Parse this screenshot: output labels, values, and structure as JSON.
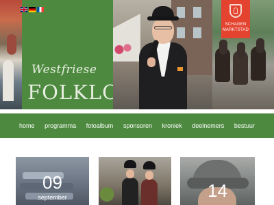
{
  "hero": {
    "title_script": "Westfriese",
    "title_main": "FOLKLORE",
    "badge": {
      "line1": "SCHAGEN",
      "line2": "MARKTSTAD",
      "color": "#e3432f",
      "icon": "shield-icon"
    }
  },
  "languages": [
    {
      "code": "en",
      "icon": "uk-flag-icon"
    },
    {
      "code": "de",
      "icon": "german-flag-icon"
    },
    {
      "code": "fr",
      "icon": "french-flag-icon"
    }
  ],
  "nav": {
    "items": [
      {
        "label": "home"
      },
      {
        "label": "programma"
      },
      {
        "label": "fotoalbum"
      },
      {
        "label": "sponsoren"
      },
      {
        "label": "kroniek"
      },
      {
        "label": "deelnemers"
      },
      {
        "label": "bestuur"
      }
    ]
  },
  "cards": [
    {
      "day": "09",
      "month": "september"
    },
    {
      "day": "",
      "month": ""
    },
    {
      "day": "14",
      "month": ""
    }
  ],
  "colors": {
    "brand_green": "#4d8a3f",
    "badge_red": "#e3432f",
    "text_light": "#ffffff"
  }
}
